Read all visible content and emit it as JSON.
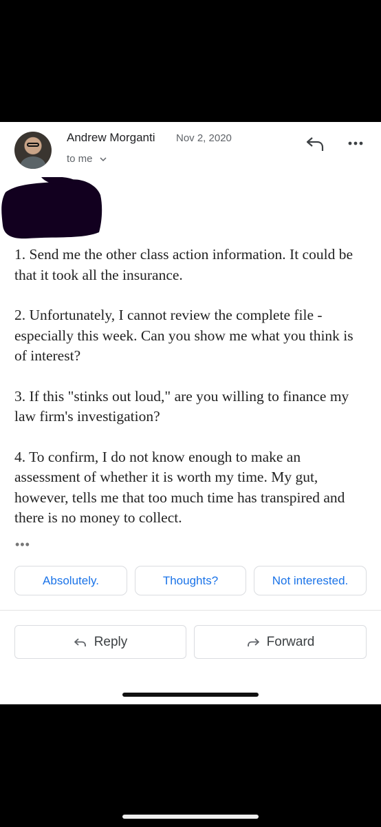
{
  "header": {
    "sender_name": "Andrew Morganti",
    "date": "Nov 2, 2020",
    "recipient": "to me"
  },
  "icons": {
    "reply": "reply-icon",
    "more": "more-vert-icon",
    "chevron": "chevron-down-icon"
  },
  "body": {
    "paragraphs": [
      "1.  Send me the other class action information.  It could be that it took all the insurance.",
      "2.  Unfortunately, I cannot review the complete file - especially this week.  Can you show me what you think is of interest?",
      "3.  If this \"stinks out loud,\" are you willing to finance my law firm's investigation?",
      "4.  To confirm, I do not know enough to make an assessment of whether it is worth my time.  My gut, however, tells me that too much time has transpired and there is no money to collect."
    ]
  },
  "smart_replies": [
    "Absolutely.",
    "Thoughts?",
    "Not interested."
  ],
  "actions": {
    "reply_label": "Reply",
    "forward_label": "Forward"
  },
  "colors": {
    "accent": "#1a73e8",
    "redaction": "#12001f"
  }
}
